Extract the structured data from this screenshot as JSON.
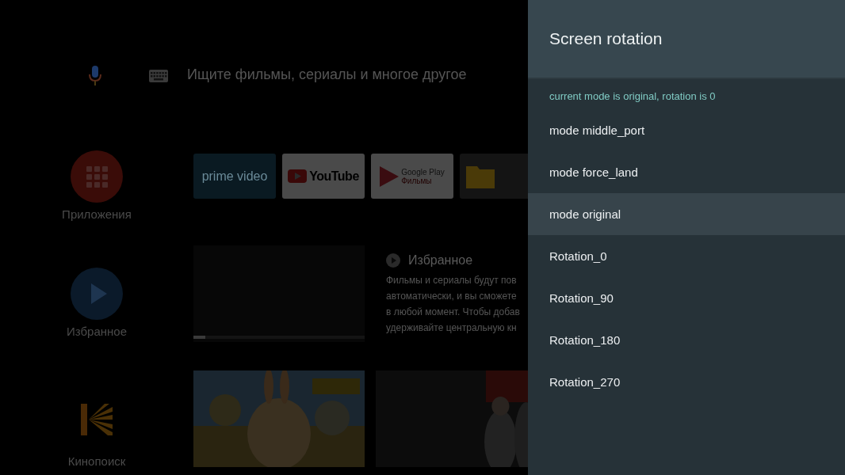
{
  "search": {
    "placeholder": "Ищите фильмы, сериалы и многое другое"
  },
  "rows": [
    {
      "kind": "apps",
      "rail_label": "Приложения",
      "tiles": [
        {
          "kind": "prime",
          "label": "prime video"
        },
        {
          "kind": "youtube",
          "label": "YouTube"
        },
        {
          "kind": "play",
          "label": "Google Play",
          "sublabel": "Фильмы"
        },
        {
          "kind": "folder"
        }
      ]
    },
    {
      "kind": "favorites",
      "rail_label": "Избранное",
      "preview": {
        "level": 0.07
      },
      "title": "Избранное",
      "description_lines": [
        "Фильмы и сериалы будут пов",
        "автоматически, и вы сможете",
        "в любой момент. Чтобы добав",
        "удерживайте центральную кн"
      ]
    },
    {
      "kind": "movies",
      "rail_label": "Кинопоиск"
    }
  ],
  "panel": {
    "title": "Screen rotation",
    "status": "current mode is original, rotation is 0",
    "items": [
      {
        "label": "mode middle_port",
        "selected": false
      },
      {
        "label": "mode force_land",
        "selected": false
      },
      {
        "label": "mode original",
        "selected": true
      },
      {
        "label": "Rotation_0",
        "selected": false
      },
      {
        "label": "Rotation_90",
        "selected": false
      },
      {
        "label": "Rotation_180",
        "selected": false
      },
      {
        "label": "Rotation_270",
        "selected": false
      }
    ]
  }
}
